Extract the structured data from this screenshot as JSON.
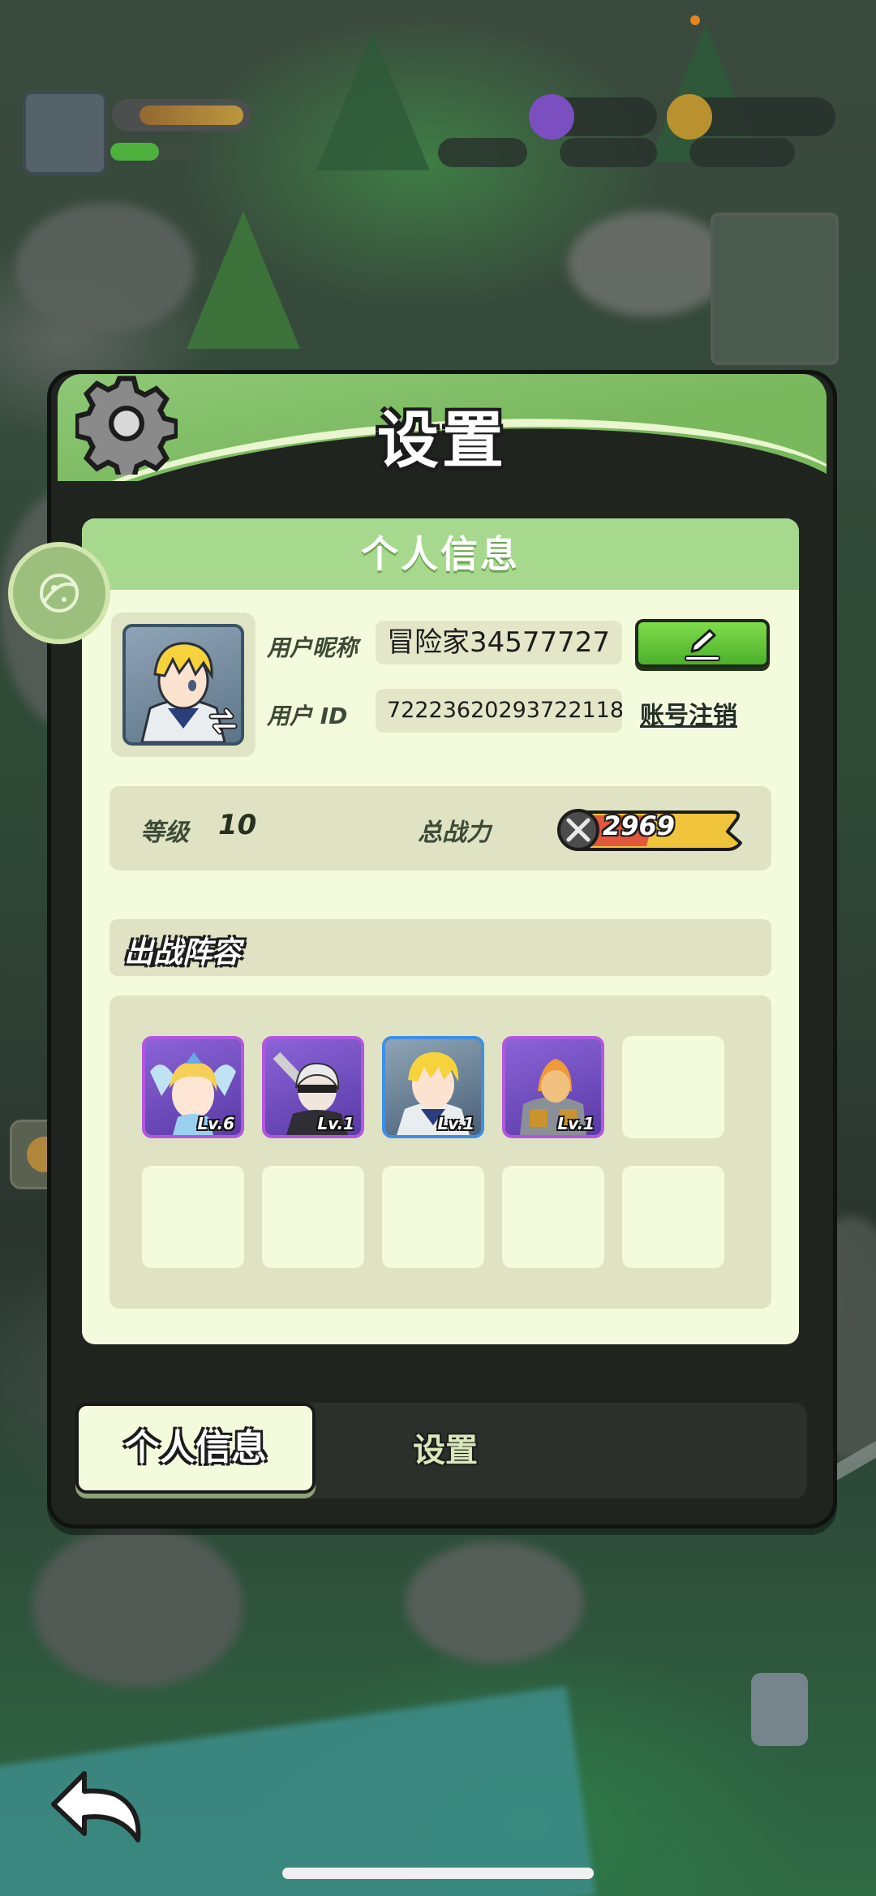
{
  "dialog": {
    "title": "设置",
    "panel_title": "个人信息"
  },
  "profile": {
    "nickname_label": "用户昵称",
    "nickname_value": "冒险家34577727",
    "id_label": "用户  ID",
    "id_value": "72223620293722118",
    "cancel_account": "账号注销"
  },
  "stats": {
    "level_label": "等级",
    "level_value": "10",
    "power_label": "总战力",
    "power_value": "2969"
  },
  "lineup": {
    "title": "出战阵容",
    "heroes": [
      {
        "level": "Lv.6",
        "frame": "purple"
      },
      {
        "level": "Lv.1",
        "frame": "purple"
      },
      {
        "level": "Lv.1",
        "frame": "blue"
      },
      {
        "level": "Lv.1",
        "frame": "purple"
      }
    ],
    "total_slots": 10
  },
  "tabs": {
    "active": "个人信息",
    "inactive": "设置"
  },
  "icons": [
    "gear-icon",
    "pencil-icon",
    "swap-icon",
    "sword-icon",
    "back-arrow-icon",
    "planet-icon"
  ],
  "colors": {
    "header_green": "#7ab85e",
    "panel_bg": "#f4fbdd",
    "edit_green": "#4cb12a",
    "epic_purple": "#b257e0",
    "rare_blue": "#3d8fe6"
  }
}
